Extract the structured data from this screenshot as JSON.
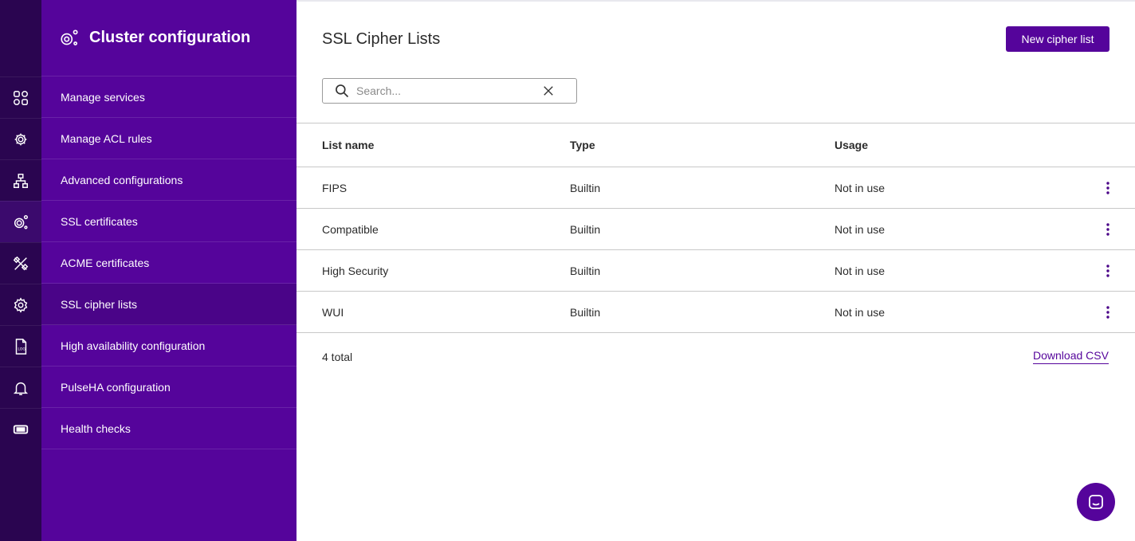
{
  "sidebar": {
    "title": "Cluster configuration",
    "items": [
      {
        "label": "Manage services",
        "icon": "grid-icon"
      },
      {
        "label": "Manage ACL rules",
        "icon": "gear-network-icon"
      },
      {
        "label": "Advanced configurations",
        "icon": "hierarchy-icon"
      },
      {
        "label": "SSL certificates",
        "icon": "gears-icon"
      },
      {
        "label": "ACME certificates",
        "icon": "tools-icon"
      },
      {
        "label": "SSL cipher lists",
        "icon": "gear-icon",
        "active": true
      },
      {
        "label": "High availability configuration",
        "icon": "log-file-icon"
      },
      {
        "label": "PulseHA configuration",
        "icon": "bell-icon"
      },
      {
        "label": "Health checks",
        "icon": "ticket-icon"
      }
    ]
  },
  "main": {
    "title": "SSL Cipher Lists",
    "new_button": "New cipher list",
    "search": {
      "placeholder": "Search...",
      "value": ""
    },
    "table": {
      "headers": [
        "List name",
        "Type",
        "Usage"
      ],
      "rows": [
        {
          "name": "FIPS",
          "type": "Builtin",
          "usage": "Not in use"
        },
        {
          "name": "Compatible",
          "type": "Builtin",
          "usage": "Not in use"
        },
        {
          "name": "High Security",
          "type": "Builtin",
          "usage": "Not in use"
        },
        {
          "name": "WUI",
          "type": "Builtin",
          "usage": "Not in use"
        }
      ]
    },
    "total": "4 total",
    "download": "Download CSV"
  },
  "colors": {
    "brand": "#55049b",
    "rail": "#2a0550"
  }
}
